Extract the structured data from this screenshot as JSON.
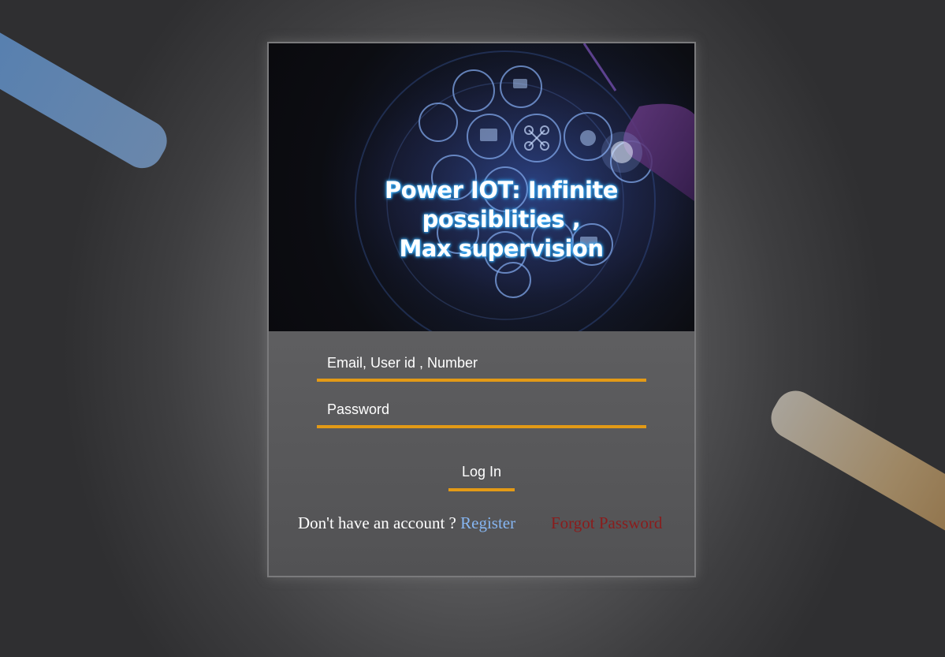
{
  "hero": {
    "title_line1": "Power IOT: Infinite possiblities ,",
    "title_line2": "Max supervision",
    "image_icon": "iot-network-hexagon-icons"
  },
  "form": {
    "identifier_placeholder": "Email, User id , Number",
    "password_placeholder": "Password",
    "login_label": "Log In",
    "no_account_text": "Don't have an account ? ",
    "register_label": "Register",
    "forgot_label": "Forgot Password"
  },
  "colors": {
    "accent": "#e39a16",
    "register_link": "#86b6f2",
    "forgot_link": "#8a1c1c",
    "decor_blue": "#5b82b0",
    "decor_tan": "#9e8764"
  }
}
